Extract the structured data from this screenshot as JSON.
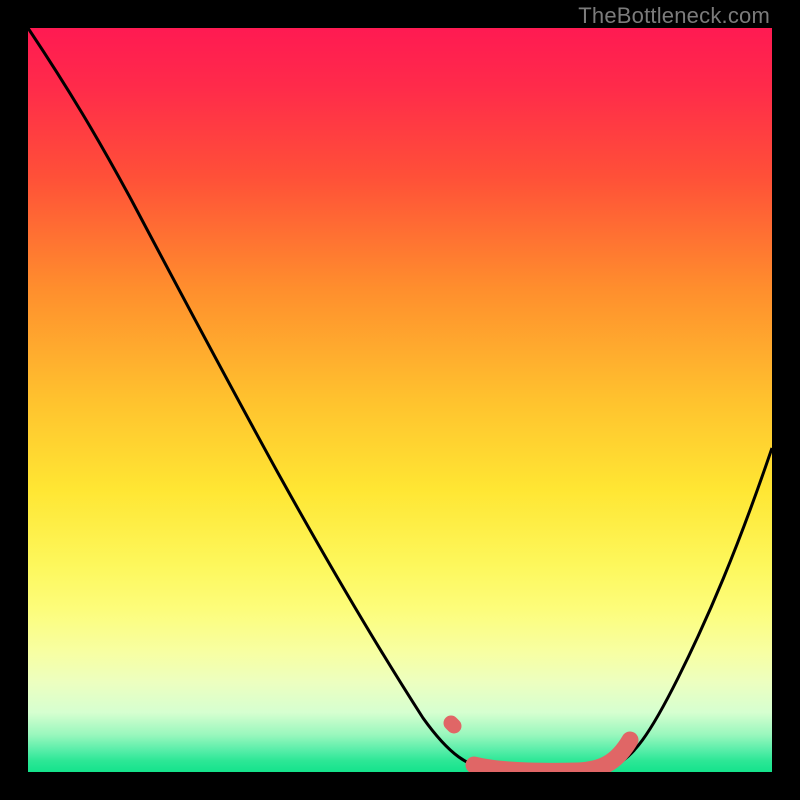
{
  "watermark": "TheBottleneck.com",
  "colors": {
    "curve": "#000000",
    "highlight": "#e06666",
    "background_top": "#ff1a52",
    "background_bottom": "#14e38c"
  },
  "chart_data": {
    "type": "line",
    "title": "",
    "xlabel": "",
    "ylabel": "",
    "xlim": [
      0,
      100
    ],
    "ylim": [
      0,
      100
    ],
    "grid": false,
    "legend": false,
    "annotations": [],
    "series": [
      {
        "name": "bottleneck-curve",
        "x": [
          0,
          6,
          14,
          22,
          30,
          38,
          46,
          52,
          56,
          60,
          64,
          70,
          74,
          78,
          82,
          88,
          94,
          100
        ],
        "y": [
          100,
          94,
          85,
          74,
          62,
          49,
          35,
          22,
          13,
          6,
          2,
          0,
          0,
          0,
          3,
          12,
          28,
          47
        ]
      },
      {
        "name": "optimal-range-highlight",
        "x": [
          57,
          60,
          64,
          70,
          74,
          78,
          80,
          81
        ],
        "y": [
          6,
          3,
          1,
          0,
          0,
          0,
          2,
          4
        ]
      }
    ],
    "background": {
      "type": "vertical-gradient",
      "note": "Color shifts from red (high bottleneck) at top through yellow to green (optimal) at bottom"
    }
  }
}
